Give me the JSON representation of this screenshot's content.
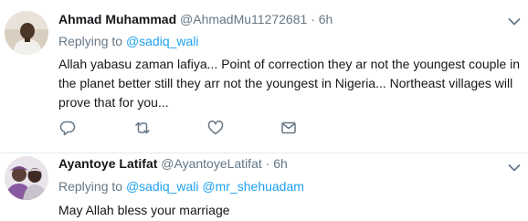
{
  "tweets": [
    {
      "name": "Ahmad Muhammad",
      "handle": "@AhmadMu11272681",
      "separator": "·",
      "time": "6h",
      "replying_to_label": "Replying to",
      "mentions": [
        "@sadiq_wali"
      ],
      "text": "Allah yabasu zaman lafiya... Point of correction they ar not the youngest couple in the planet better still they arr not the youngest  in Nigeria... Northeast villages will prove that for you...",
      "actions": [
        "reply-icon",
        "retweet-icon",
        "like-icon",
        "message-icon"
      ]
    },
    {
      "name": "Ayantoye Latifat",
      "handle": "@AyantoyeLatifat",
      "separator": "·",
      "time": "6h",
      "replying_to_label": "Replying to",
      "mentions": [
        "@sadiq_wali",
        "@mr_shehuadam"
      ],
      "text": "May Allah bless your marriage"
    }
  ],
  "colors": {
    "link": "#1da1f2",
    "secondary_text": "#657786",
    "primary_text": "#14171a",
    "divider": "#e6ecf0"
  }
}
